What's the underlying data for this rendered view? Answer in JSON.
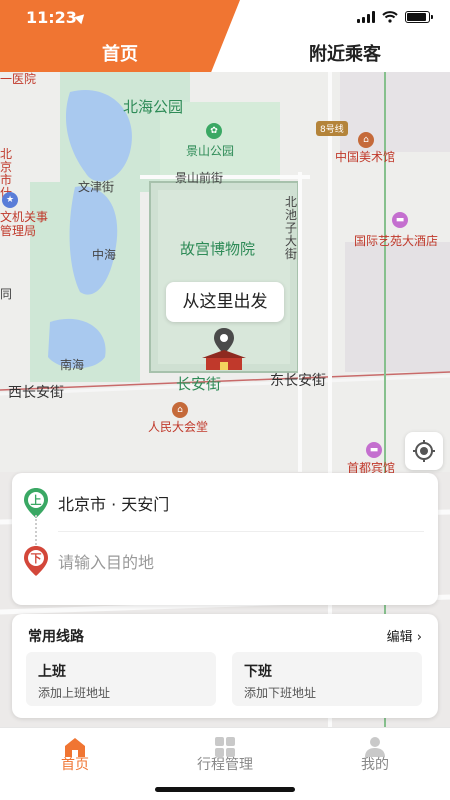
{
  "status_bar": {
    "time": "11:23",
    "battery_level": 0.9
  },
  "header": {
    "tabs": [
      {
        "label": "首页",
        "active": true
      },
      {
        "label": "附近乘客",
        "active": false
      }
    ],
    "accent_color": "#f07532"
  },
  "map": {
    "labels": {
      "beihai_park": "北海公园",
      "jingshan_park": "景山公园",
      "jingshan_qianjie": "景山前街",
      "wenjin_street": "文津街",
      "forbidden_city": "故宫博物院",
      "beichizi": "北池子大街",
      "zhonghai": "中海",
      "nanhai": "南海",
      "xichangan": "西长安街",
      "changan": "长安街",
      "dongchangan": "东长安街",
      "great_hall": "人民大会堂",
      "art_museum": "中国美术馆",
      "yiyuan_hotel": "国际艺苑大酒店",
      "capital_hotel": "首都宾馆",
      "yiyuan_left": "一医院",
      "beijing_left": "北京市什",
      "jiguan_left": "文机关事",
      "guanliju_left": "管理局",
      "tong_left": "同",
      "metro_line": "8号线"
    },
    "depart_bubble": "从这里出发"
  },
  "address": {
    "start_badge": "上",
    "start_value": "北京市 · 天安门",
    "end_badge": "下",
    "end_placeholder": "请输入目的地"
  },
  "routes": {
    "title": "常用线路",
    "edit": "编辑 ›",
    "items": [
      {
        "name": "上班",
        "sub": "添加上班地址"
      },
      {
        "name": "下班",
        "sub": "添加下班地址"
      }
    ]
  },
  "bottom_nav": {
    "items": [
      {
        "label": "首页",
        "icon": "home-icon",
        "active": true
      },
      {
        "label": "行程管理",
        "icon": "grid-icon",
        "active": false
      },
      {
        "label": "我的",
        "icon": "user-icon",
        "active": false
      }
    ]
  }
}
